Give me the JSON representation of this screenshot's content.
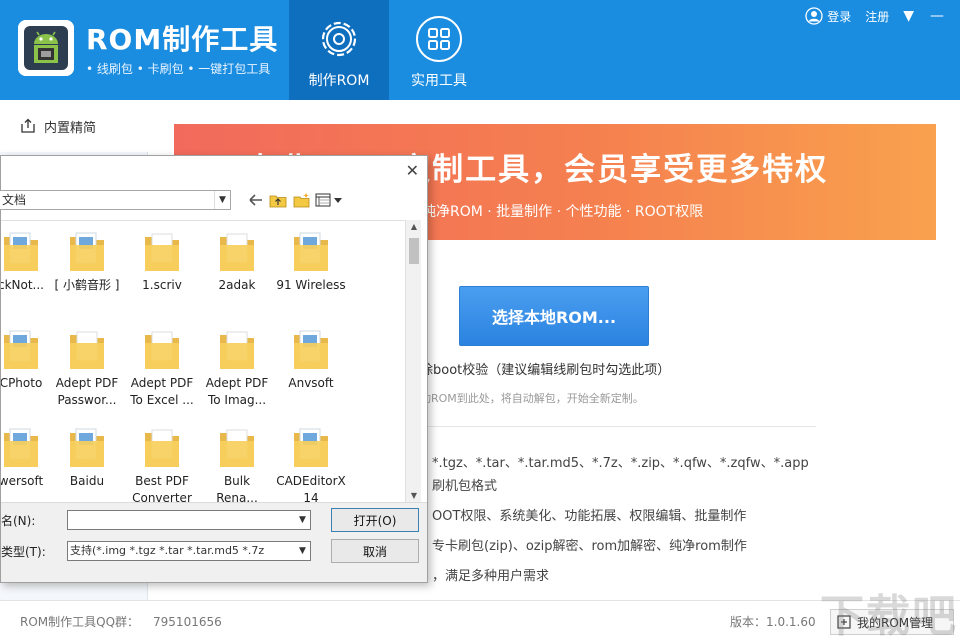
{
  "header": {
    "app_title": "ROM制作工具",
    "app_subtitle": "• 线刷包  • 卡刷包  • 一键打包工具",
    "tabs": [
      {
        "label": "制作ROM",
        "icon": "gear-icon",
        "active": true
      },
      {
        "label": "实用工具",
        "icon": "grid-icon",
        "active": false
      }
    ],
    "login": "登录",
    "register": "注册"
  },
  "sidebar": {
    "items": [
      {
        "label": "内置精简",
        "icon": "export-icon"
      }
    ]
  },
  "banner": {
    "title": "专业ROM定制工具，会员享受更多特权",
    "subtitle": "纯净ROM · 批量制作 · 个性功能 · ROOT权限"
  },
  "main": {
    "select_button": "选择本地ROM...",
    "boot_option": "除boot校验（建议编辑线刷包时勾选此项）",
    "hint": "动ROM到此处，将自动解包，开始全新定制。",
    "info_lines": [
      "*.tgz、*.tar、*.tar.md5、*.7z、*.zip、*.qfw、*.zqfw、*.app",
      "刷机包格式",
      "OOT权限、系统美化、功能拓展、权限编辑、批量制作",
      "专卡刷包(zip)、ozip解密、rom加解密、纯净rom制作",
      "，满足多种用户需求"
    ]
  },
  "footer": {
    "qq_label": "ROM制作工具QQ群：",
    "qq_number": "795101656",
    "version": "版本：1.0.1.60",
    "rom_manage": "我的ROM管理"
  },
  "watermark": "下载吧",
  "dialog": {
    "look_in": "文档",
    "close": "✕",
    "files": [
      {
        "name": "ckNot...",
        "type": "folder-doc"
      },
      {
        "name": "[ 小鹤音形 ]",
        "type": "folder-doc"
      },
      {
        "name": "1.scriv",
        "type": "folder-plain"
      },
      {
        "name": "2adak",
        "type": "folder-plain"
      },
      {
        "name": "91 Wireless",
        "type": "folder-doc"
      },
      {
        "name": "CPhoto",
        "type": "folder-doc"
      },
      {
        "name": "Adept PDF\nPasswor...",
        "type": "folder-plain"
      },
      {
        "name": "Adept PDF\nTo Excel ...",
        "type": "folder-plain"
      },
      {
        "name": "Adept PDF\nTo Imag...",
        "type": "folder-plain"
      },
      {
        "name": "Anvsoft",
        "type": "folder-doc"
      },
      {
        "name": "wersoft",
        "type": "folder-doc"
      },
      {
        "name": "Baidu",
        "type": "folder-doc"
      },
      {
        "name": "Best PDF\nConverter",
        "type": "folder-plain"
      },
      {
        "name": "Bulk\nRena...",
        "type": "folder-plain"
      },
      {
        "name": "CADEditorX\n14",
        "type": "folder-doc"
      }
    ],
    "filename_label": "名(N):",
    "filename_value": "",
    "filetype_label": "类型(T):",
    "filetype_value": "支持(*.img *.tgz *.tar *.tar.md5 *.7z",
    "open_button": "打开(O)",
    "cancel_button": "取消"
  },
  "colors": {
    "header_bg": "#1a8de0",
    "header_active": "#0f6fbf",
    "banner_start": "#f26a5c",
    "banner_end": "#f9a14e",
    "button_blue": "#2b83e0"
  }
}
